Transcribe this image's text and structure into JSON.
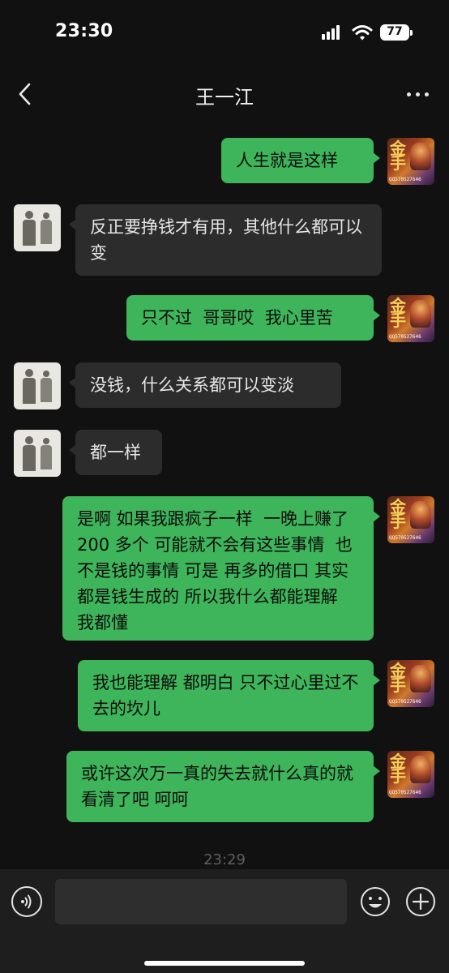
{
  "status_bar": {
    "time": "23:30",
    "battery_level": "77",
    "signal_icon": "cellular-signal-icon",
    "wifi_icon": "wifi-icon"
  },
  "nav": {
    "back_icon": "chevron-left-icon",
    "title": "王一江",
    "more_icon": "more-dots-icon"
  },
  "avatars": {
    "self_lettering": "金手",
    "self_qq_text": "QQ570527646"
  },
  "messages": [
    {
      "sender": "self",
      "text": "人生就是这样"
    },
    {
      "sender": "other",
      "text": "反正要挣钱才有用，其他什么都可以变"
    },
    {
      "sender": "self",
      "text": "只不过  哥哥哎  我心里苦"
    },
    {
      "sender": "other",
      "text": "没钱，什么关系都可以变淡"
    },
    {
      "sender": "other",
      "text": "都一样"
    },
    {
      "sender": "self",
      "text": "是啊 如果我跟疯子一样  一晚上赚了 200 多个 可能就不会有这些事情  也不是钱的事情 可是 再多的借口 其实都是钱生成的 所以我什么都能理解 我都懂"
    },
    {
      "sender": "self",
      "text": "我也能理解 都明白 只不过心里过不去的坎儿"
    },
    {
      "sender": "self",
      "text": "或许这次万一真的失去就什么真的就看清了吧 呵呵"
    }
  ],
  "timestamp": "23:29",
  "input_bar": {
    "voice_icon": "voice-icon",
    "input_value": "",
    "emoji_icon": "emoji-icon",
    "add_icon": "plus-icon"
  },
  "colors": {
    "background": "#111111",
    "bubble_self": "#3eb55a",
    "bubble_other": "#2c2c2c"
  }
}
